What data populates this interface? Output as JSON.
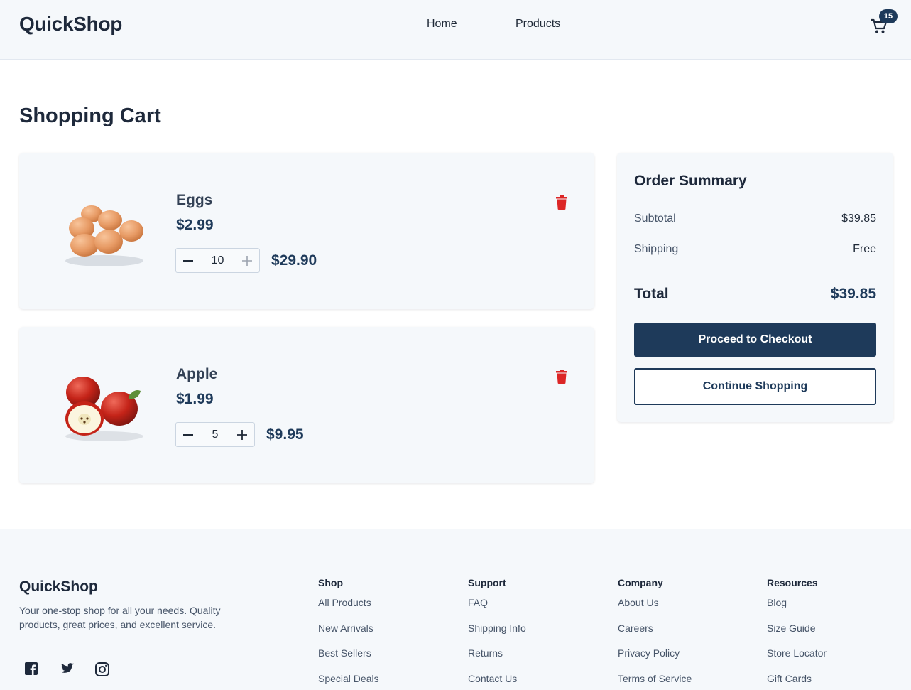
{
  "header": {
    "logo": "QuickShop",
    "nav": [
      {
        "label": "Home"
      },
      {
        "label": "Products"
      }
    ],
    "cart_count": "15"
  },
  "page": {
    "title": "Shopping Cart"
  },
  "cart": {
    "items": [
      {
        "name": "Eggs",
        "price": "$2.99",
        "quantity": "10",
        "line_total": "$29.90",
        "image": "eggs-image"
      },
      {
        "name": "Apple",
        "price": "$1.99",
        "quantity": "5",
        "line_total": "$9.95",
        "image": "apple-image"
      }
    ]
  },
  "summary": {
    "title": "Order Summary",
    "subtotal_label": "Subtotal",
    "subtotal_value": "$39.85",
    "shipping_label": "Shipping",
    "shipping_value": "Free",
    "total_label": "Total",
    "total_value": "$39.85",
    "checkout_label": "Proceed to Checkout",
    "continue_label": "Continue Shopping"
  },
  "footer": {
    "brand": "QuickShop",
    "description": "Your one-stop shop for all your needs. Quality products, great prices, and excellent service.",
    "social": [
      "facebook-icon",
      "twitter-icon",
      "instagram-icon"
    ],
    "columns": [
      {
        "title": "Shop",
        "links": [
          "All Products",
          "New Arrivals",
          "Best Sellers",
          "Special Deals"
        ]
      },
      {
        "title": "Support",
        "links": [
          "FAQ",
          "Shipping Info",
          "Returns",
          "Contact Us"
        ]
      },
      {
        "title": "Company",
        "links": [
          "About Us",
          "Careers",
          "Privacy Policy",
          "Terms of Service"
        ]
      },
      {
        "title": "Resources",
        "links": [
          "Blog",
          "Size Guide",
          "Store Locator",
          "Gift Cards"
        ]
      }
    ]
  },
  "colors": {
    "primary": "#1e3a5a",
    "danger": "#dc2626",
    "panel": "#f5f8fb"
  }
}
